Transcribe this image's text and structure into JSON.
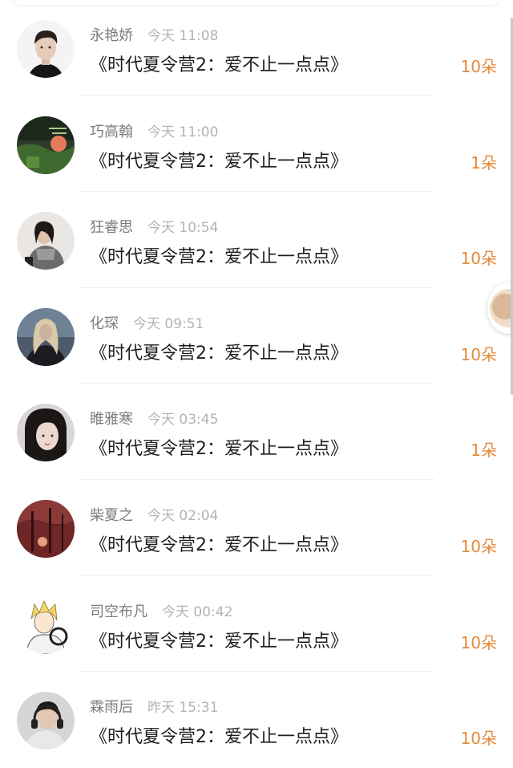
{
  "colors": {
    "name": "#7d7d7d",
    "time": "#b3b3b3",
    "content": "#1e1e1e",
    "gift": "#e58a3a"
  },
  "entries": [
    {
      "name": "永艳娇",
      "time": "今天 11:08",
      "content": "《时代夏令营2：爱不止一点点》",
      "gift": "10朵",
      "avatar_icon": "man-portrait-avatar"
    },
    {
      "name": "巧高翰",
      "time": "今天 11:00",
      "content": "《时代夏令营2：爱不止一点点》",
      "gift": "1朵",
      "avatar_icon": "green-text-avatar"
    },
    {
      "name": "狂睿思",
      "time": "今天 10:54",
      "content": "《时代夏令营2：爱不止一点点》",
      "gift": "10朵",
      "avatar_icon": "girl-hoodie-avatar"
    },
    {
      "name": "化琛",
      "time": "今天 09:51",
      "content": "《时代夏令营2：爱不止一点点》",
      "gift": "10朵",
      "avatar_icon": "blonde-girl-avatar"
    },
    {
      "name": "睢雅寒",
      "time": "今天 03:45",
      "content": "《时代夏令营2：爱不止一点点》",
      "gift": "1朵",
      "avatar_icon": "dark-hair-girl-avatar"
    },
    {
      "name": "柴夏之",
      "time": "今天 02:04",
      "content": "《时代夏令营2：爱不止一点点》",
      "gift": "10朵",
      "avatar_icon": "red-forest-avatar"
    },
    {
      "name": "司空布凡",
      "time": "今天 00:42",
      "content": "《时代夏令营2：爱不止一点点》",
      "gift": "10朵",
      "avatar_icon": "anime-boy-avatar"
    },
    {
      "name": "霖雨后",
      "time": "昨天 15:31",
      "content": "《时代夏令营2：爱不止一点点》",
      "gift": "10朵",
      "avatar_icon": "headphone-boy-avatar"
    }
  ]
}
